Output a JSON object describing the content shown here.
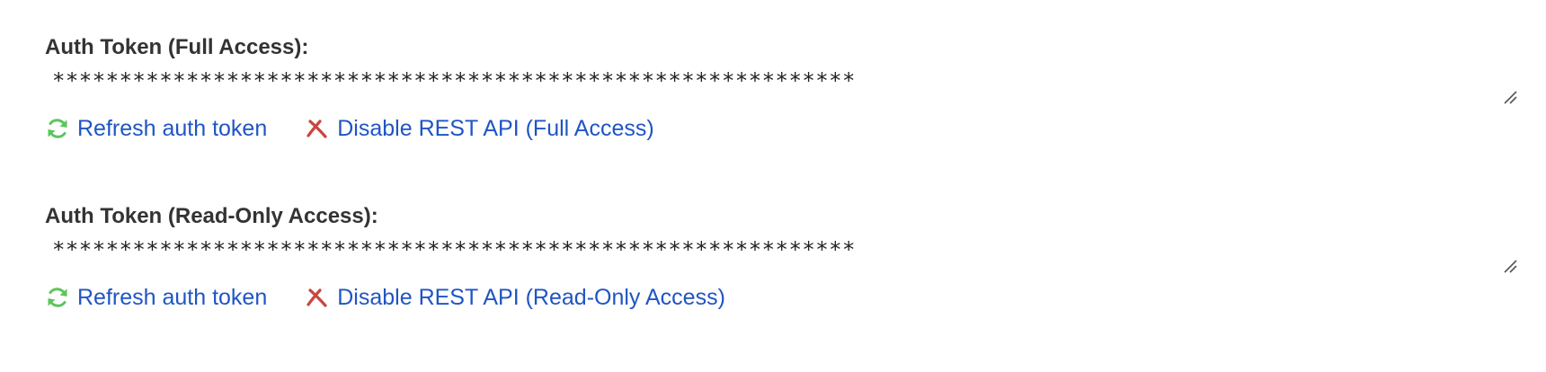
{
  "sections": [
    {
      "label": "Auth Token (Full Access):",
      "token_value": "************************************************************",
      "actions": {
        "refresh_label": "Refresh auth token",
        "disable_label": "Disable REST API (Full Access)"
      }
    },
    {
      "label": "Auth Token (Read-Only Access):",
      "token_value": "************************************************************",
      "actions": {
        "refresh_label": "Refresh auth token",
        "disable_label": "Disable REST API (Read-Only Access)"
      }
    }
  ],
  "icons": {
    "refresh": "refresh-icon",
    "disable": "close-icon"
  },
  "colors": {
    "link": "#1f55c4",
    "refresh_icon": "#5cc55c",
    "disable_icon": "#c9463d",
    "label": "#333333"
  }
}
